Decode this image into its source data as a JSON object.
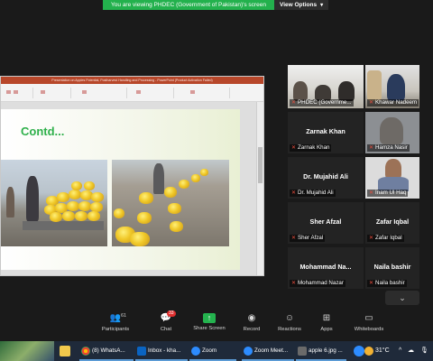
{
  "banner": {
    "sharing_text": "You are viewing PHDEC (Government of Pakistan)'s screen",
    "view_options_label": "View Options"
  },
  "shared_screen": {
    "window_title": "Presentation on Apples Potential, Postharvest Handling and Processing - PowerPoint (Product Activation Failed)",
    "slide_title": "Contd..."
  },
  "participants": [
    {
      "label": "PHDEC (Governme...",
      "has_video": true
    },
    {
      "label": "Khawar Nadeem",
      "has_video": true
    },
    {
      "big_name": "Zarnak Khan",
      "label": "Zarnak Khan",
      "has_video": false
    },
    {
      "label": "Hamza Nasir",
      "has_video": true
    },
    {
      "big_name": "Dr. Mujahid Ali",
      "label": "Dr. Mujahid Ali",
      "has_video": false
    },
    {
      "label": "Inam Ul Haq",
      "has_video": true
    },
    {
      "big_name": "Sher Afzal",
      "label": "Sher Afzal",
      "has_video": false
    },
    {
      "big_name": "Zafar Iqbal",
      "label": "Zafar Iqbal",
      "has_video": false
    },
    {
      "big_name": "Mohammad  Na...",
      "label": "Mohammad Nazar",
      "has_video": false
    },
    {
      "big_name": "Naila bashir",
      "label": "Naila bashir",
      "has_video": false
    }
  ],
  "toolbar": {
    "participants_label": "Participants",
    "participants_count": "61",
    "chat_label": "Chat",
    "chat_badge": "33",
    "share_label": "Share Screen",
    "record_label": "Record",
    "reactions_label": "Reactions",
    "apps_label": "Apps",
    "whiteboards_label": "Whiteboards"
  },
  "taskbar": {
    "items": [
      "(8) WhatsA...",
      "Inbox - kha...",
      "Zoom",
      "Zoom Meet...",
      "apple 6.jpg ..."
    ],
    "temperature": "31°C"
  },
  "colors": {
    "share_green": "#23b14d",
    "slide_title_green": "#2eb04a",
    "ppt_titlebar": "#b7472a",
    "badge_red": "#e02f2f",
    "muted_mic_red": "#e74c3c"
  },
  "icons": {
    "scroll_down": "chevron-down-icon",
    "view_options": "chevron-down-icon"
  }
}
